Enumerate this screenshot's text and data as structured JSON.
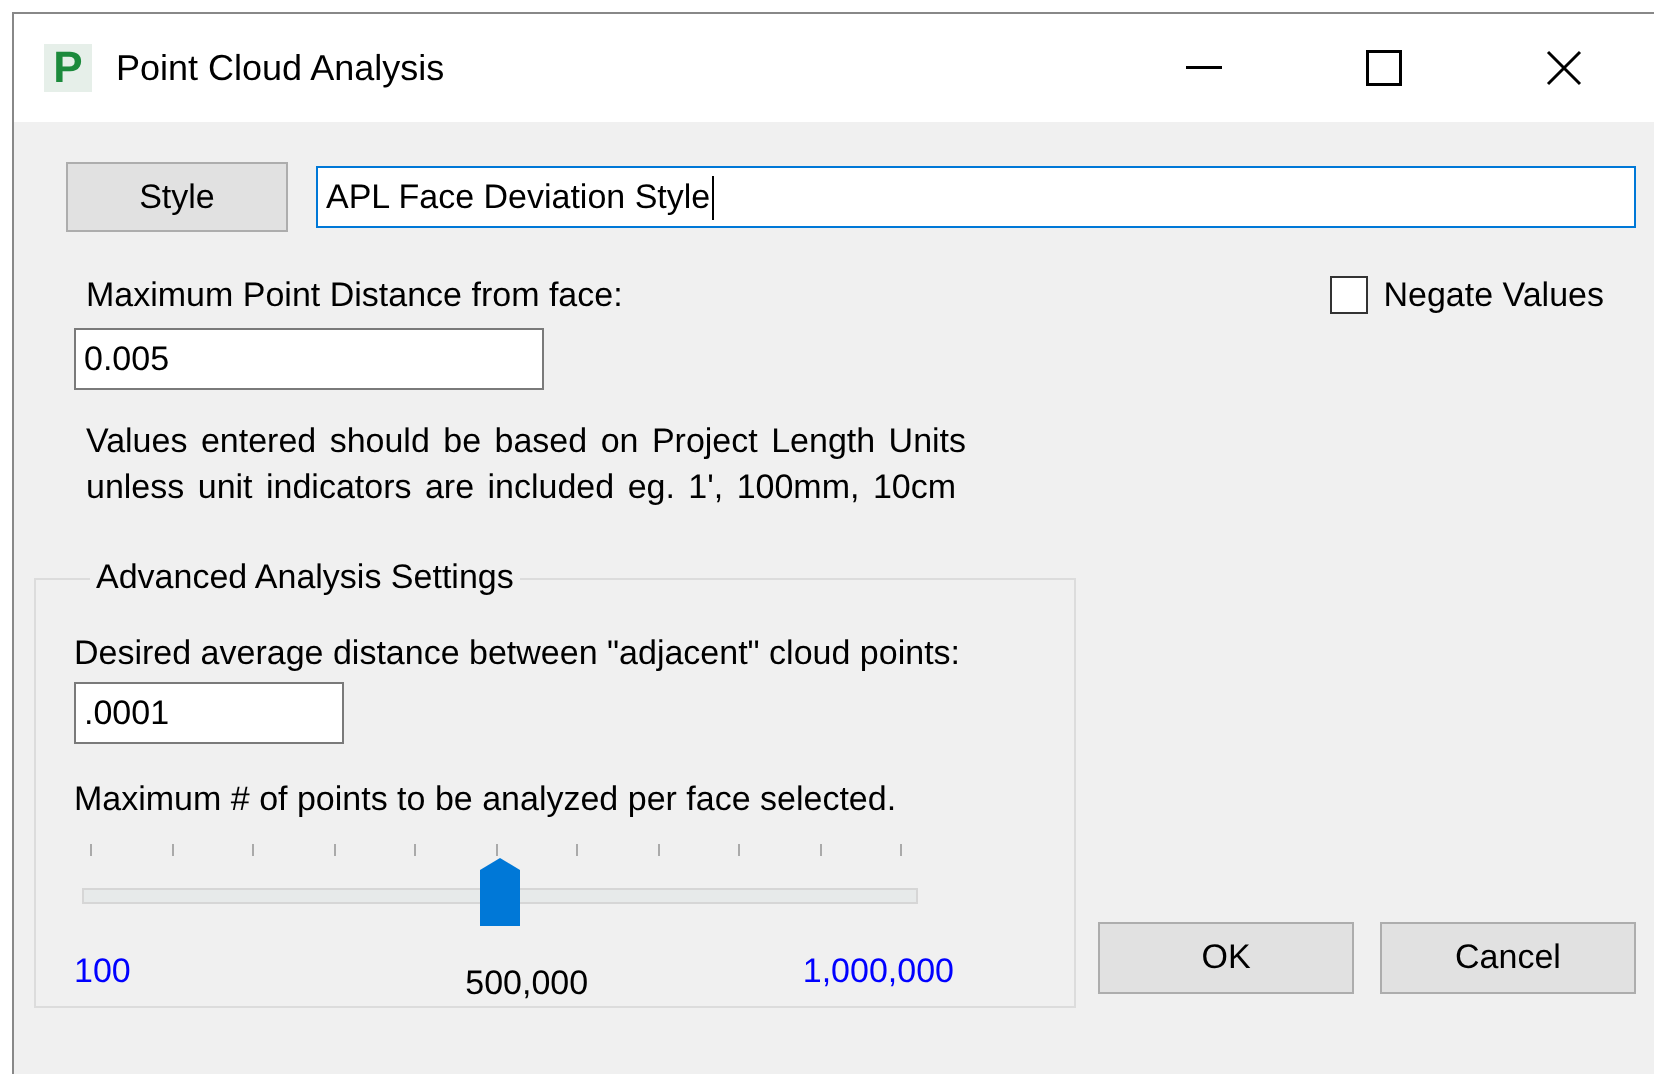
{
  "window": {
    "title": "Point Cloud Analysis",
    "icon_letter": "P"
  },
  "style": {
    "button": "Style",
    "value": "APL Face Deviation Style"
  },
  "max_distance": {
    "label": "Maximum Point Distance from face:",
    "value": "0.005"
  },
  "negate": {
    "label": "Negate Values",
    "checked": false
  },
  "note": "Values entered should be based on Project Length Units unless unit indicators are included eg. 1', 100mm, 10cm",
  "advanced": {
    "legend": "Advanced Analysis Settings",
    "spacing_label": "Desired average distance between \"adjacent\" cloud points:",
    "spacing_value": ".0001",
    "points_label": "Maximum # of points to be analyzed per face selected.",
    "slider": {
      "level": 0.5,
      "min_label": "100",
      "value_label": "500,000",
      "max_label": "1,000,000"
    }
  },
  "buttons": [
    "OK",
    "Cancel"
  ]
}
